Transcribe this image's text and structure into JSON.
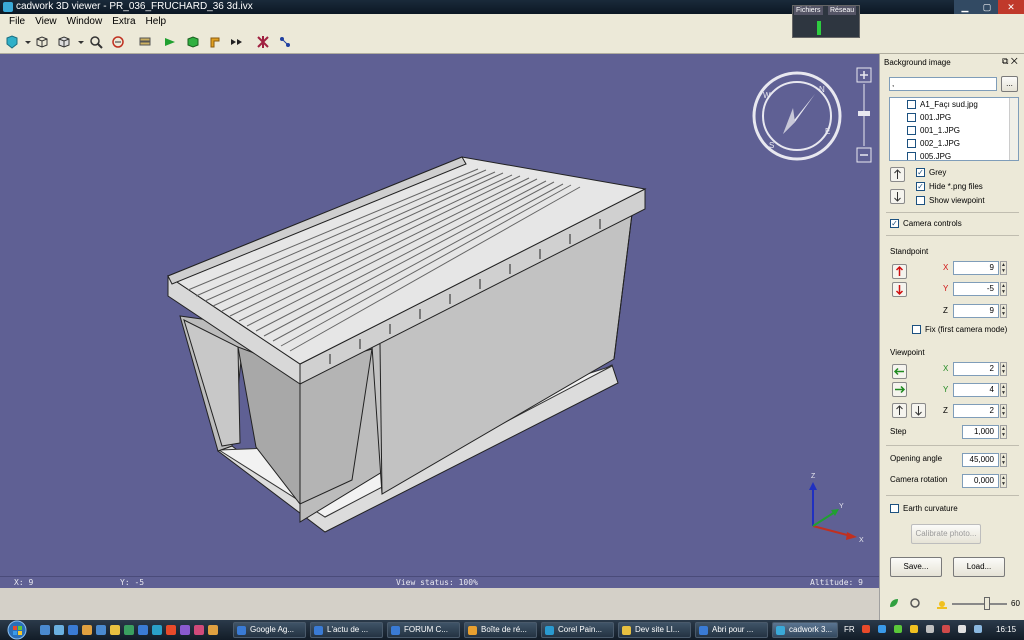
{
  "window": {
    "title": "cadwork 3D viewer - PR_036_FRUCHARD_36 3d.ivx"
  },
  "net_meter": {
    "label_a": "Fichiers",
    "label_b": "Réseau"
  },
  "menu": {
    "items": [
      "File",
      "View",
      "Window",
      "Extra",
      "Help"
    ]
  },
  "toolbar": {
    "icons": [
      "shaded-view-icon",
      "dropdown-icon",
      "wireframe-cube-icon",
      "cube-view-icon",
      "dropdown-icon",
      "zoom-icon",
      "navigate-icon",
      "layers-icon",
      "green-arrow-icon",
      "green-cube-icon",
      "orange-bracket-icon",
      "play-icon",
      "section-icon",
      "points-icon"
    ]
  },
  "status": {
    "x": "X: 9",
    "y": "Y: -5",
    "view_status": "View status: 100%",
    "altitude": "Altitude: 9"
  },
  "axes": {
    "x": "X",
    "y": "Y",
    "z": "Z"
  },
  "compass": {
    "n": "N",
    "s": "S",
    "e": "E",
    "w": "W"
  },
  "panel": {
    "title": "Background image",
    "path_value": ",",
    "browse_label": "...",
    "files": [
      "A1_Façı sud.jpg",
      "001.JPG",
      "001_1.JPG",
      "002_1.JPG",
      "005.JPG"
    ],
    "grey_label": "Grey",
    "grey_checked": true,
    "hide_png_label": "Hide *.png files",
    "hide_png_checked": true,
    "show_viewpoint_label": "Show viewpoint",
    "show_viewpoint_checked": false,
    "camera_controls_label": "Camera controls",
    "camera_controls_checked": true,
    "standpoint_label": "Standpoint",
    "standpoint": {
      "x_label": "X",
      "x": "9",
      "y_label": "Y",
      "y": "-5",
      "z_label": "Z",
      "z": "9"
    },
    "fix_label": "Fix (first camera mode)",
    "fix_checked": false,
    "viewpoint_label": "Viewpoint",
    "viewpoint": {
      "x_label": "X",
      "x": "2",
      "y_label": "Y",
      "y": "4",
      "z_label": "Z",
      "z": "2"
    },
    "step_label": "Step",
    "step": "1,000",
    "opening_angle_label": "Opening angle",
    "opening_angle": "45,000",
    "camera_rotation_label": "Camera rotation",
    "camera_rotation": "0,000",
    "earth_curvature_label": "Earth curvature",
    "earth_curvature_checked": false,
    "calibrate_label": "Calibrate photo...",
    "save_label": "Save...",
    "load_label": "Load...",
    "zoom_value": "60"
  },
  "taskbar": {
    "tasks": [
      {
        "label": "Google Ag...",
        "color": "#3a7bd5"
      },
      {
        "label": "L'actu de ...",
        "color": "#3a7bd5"
      },
      {
        "label": "FORUM C...",
        "color": "#3a7bd5"
      },
      {
        "label": "Boîte de ré...",
        "color": "#e8a030"
      },
      {
        "label": "Corel Pain...",
        "color": "#2a9ad0"
      },
      {
        "label": "Dev site LI...",
        "color": "#e8c040"
      },
      {
        "label": "Abri pour ...",
        "color": "#3a7bd5"
      },
      {
        "label": "cadwork 3...",
        "color": "#3aa9d8"
      }
    ],
    "lang": "FR",
    "clock": "16:15"
  }
}
